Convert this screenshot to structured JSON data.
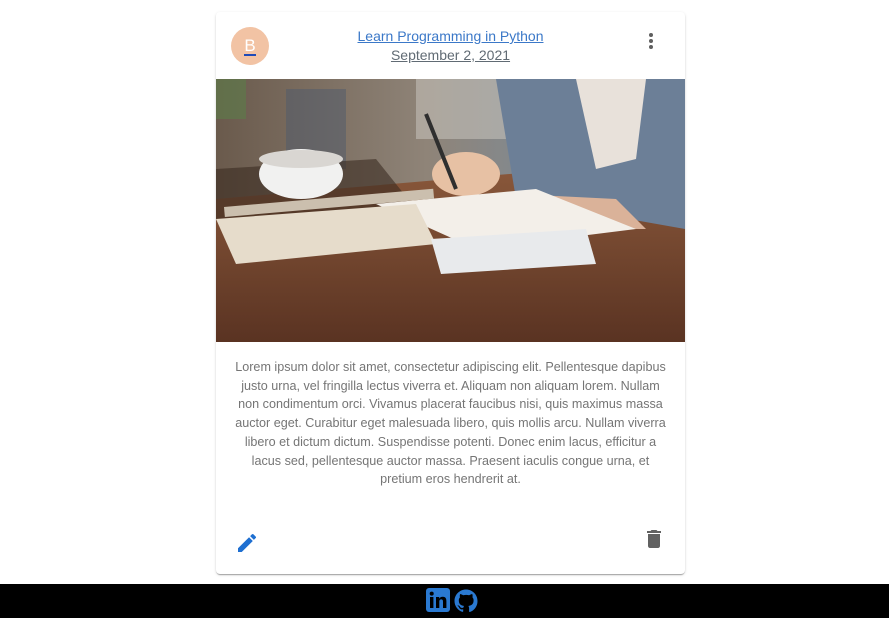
{
  "post": {
    "avatar_letter": "B",
    "title": "Learn Programming in Python",
    "date": "September 2, 2021",
    "menu_icon": "more-vert-icon",
    "image_description": "person writing in notebook at wooden desk with coffee cup and phone",
    "body": "Lorem ipsum dolor sit amet, consectetur adipiscing elit. Pellentesque dapibus justo urna, vel fringilla lectus viverra et. Aliquam non aliquam lorem. Nullam non condimentum orci. Vivamus placerat faucibus nisi, quis maximus massa auctor eget. Curabitur eget malesuada libero, quis mollis arcu. Nullam viverra libero et dictum dictum. Suspendisse potenti. Donec enim lacus, efficitur a lacus sed, pellentesque auctor massa. Praesent iaculis congue urna, et pretium eros hendrerit at.",
    "actions": {
      "edit_icon": "edit-icon",
      "delete_icon": "delete-icon"
    }
  },
  "footer": {
    "icons": [
      "linkedin-icon",
      "github-icon"
    ]
  },
  "colors": {
    "link": "#3b78c8",
    "avatar_bg": "#f2c3a4",
    "edit": "#1e6fd1",
    "delete": "#616161",
    "footer_bg": "#000000",
    "footer_icon": "#2a79d1"
  }
}
